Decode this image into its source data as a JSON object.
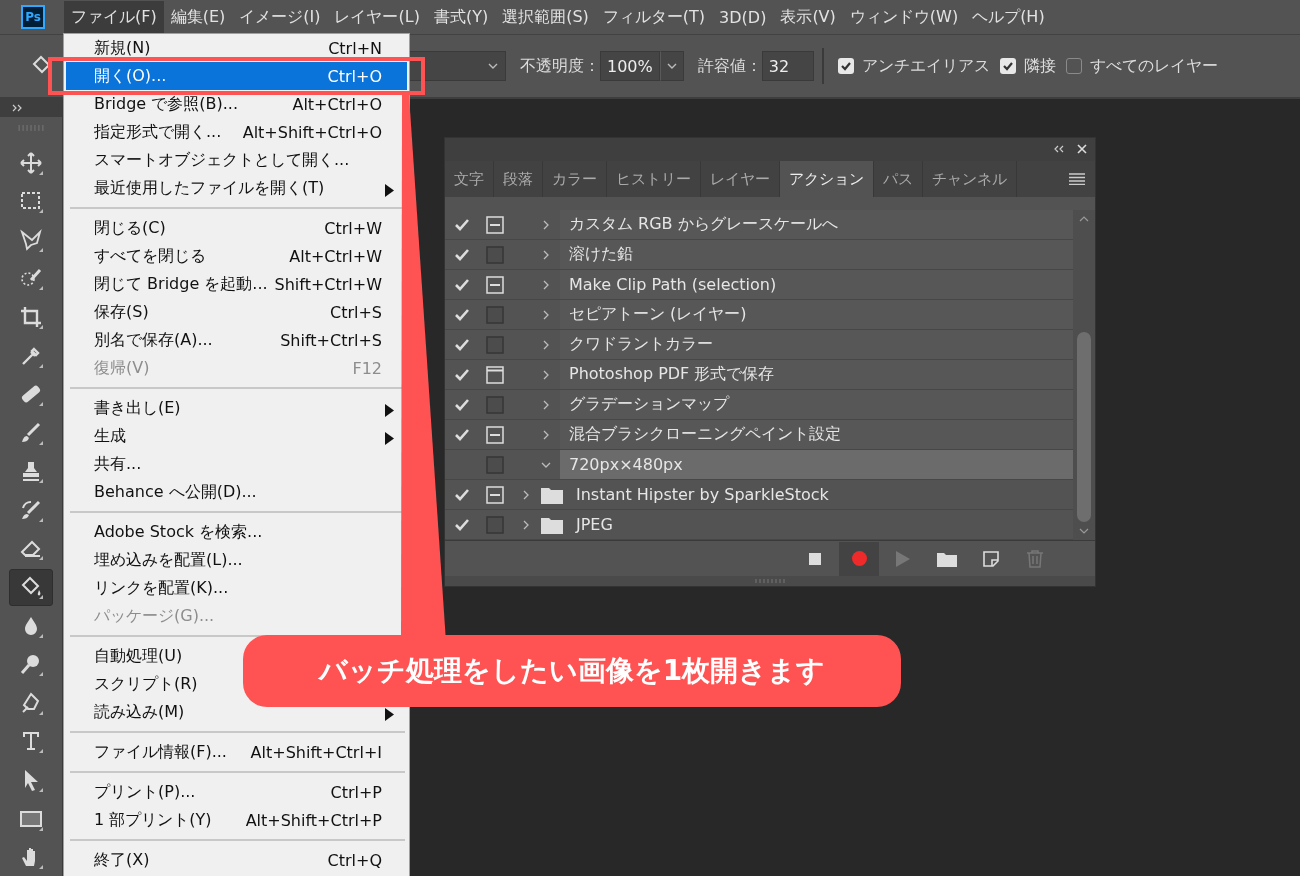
{
  "app_logo": "Ps",
  "menubar": [
    {
      "label": "ファイル(F)",
      "selected": true
    },
    {
      "label": "編集(E)",
      "selected": false
    },
    {
      "label": "イメージ(I)",
      "selected": false
    },
    {
      "label": "レイヤー(L)",
      "selected": false
    },
    {
      "label": "書式(Y)",
      "selected": false
    },
    {
      "label": "選択範囲(S)",
      "selected": false
    },
    {
      "label": "フィルター(T)",
      "selected": false
    },
    {
      "label": "3D(D)",
      "selected": false
    },
    {
      "label": "表示(V)",
      "selected": false
    },
    {
      "label": "ウィンドウ(W)",
      "selected": false
    },
    {
      "label": "ヘルプ(H)",
      "selected": false
    }
  ],
  "options_bar": {
    "opacity_label": "不透明度：",
    "opacity_value": "100%",
    "tolerance_label": "許容値：",
    "tolerance_value": "32",
    "checkboxes": [
      {
        "label": "アンチエイリアス",
        "checked": true
      },
      {
        "label": "隣接",
        "checked": true
      },
      {
        "label": "すべてのレイヤー",
        "checked": false
      }
    ]
  },
  "tools": [
    {
      "kind": "move",
      "selected": false
    },
    {
      "kind": "marquee",
      "selected": false
    },
    {
      "kind": "lasso",
      "selected": false
    },
    {
      "kind": "quick-select",
      "selected": false
    },
    {
      "kind": "crop",
      "selected": false
    },
    {
      "kind": "eyedropper",
      "selected": false
    },
    {
      "kind": "healing",
      "selected": false
    },
    {
      "kind": "brush",
      "selected": false
    },
    {
      "kind": "stamp",
      "selected": false
    },
    {
      "kind": "history-brush",
      "selected": false
    },
    {
      "kind": "eraser",
      "selected": false
    },
    {
      "kind": "bucket",
      "selected": true
    },
    {
      "kind": "blur",
      "selected": false
    },
    {
      "kind": "dodge",
      "selected": false
    },
    {
      "kind": "pen",
      "selected": false
    },
    {
      "kind": "type",
      "selected": false
    },
    {
      "kind": "path-select",
      "selected": false
    },
    {
      "kind": "rectangle",
      "selected": false
    },
    {
      "kind": "hand",
      "selected": false
    }
  ],
  "file_menu": [
    {
      "kind": "item",
      "label": "新規(N)",
      "shortcut": "Ctrl+N",
      "selected": false,
      "disabled": false,
      "submenu": false
    },
    {
      "kind": "item",
      "label": "開く(O)...",
      "shortcut": "Ctrl+O",
      "selected": true,
      "disabled": false,
      "submenu": false
    },
    {
      "kind": "item",
      "label": "Bridge で参照(B)...",
      "shortcut": "Alt+Ctrl+O",
      "selected": false,
      "disabled": false,
      "submenu": false
    },
    {
      "kind": "item",
      "label": "指定形式で開く...",
      "shortcut": "Alt+Shift+Ctrl+O",
      "selected": false,
      "disabled": false,
      "submenu": false
    },
    {
      "kind": "item",
      "label": "スマートオブジェクトとして開く...",
      "selected": false,
      "disabled": false,
      "submenu": false
    },
    {
      "kind": "item",
      "label": "最近使用したファイルを開く(T)",
      "selected": false,
      "disabled": false,
      "submenu": true
    },
    {
      "kind": "separator"
    },
    {
      "kind": "item",
      "label": "閉じる(C)",
      "shortcut": "Ctrl+W",
      "selected": false,
      "disabled": false,
      "submenu": false
    },
    {
      "kind": "item",
      "label": "すべてを閉じる",
      "shortcut": "Alt+Ctrl+W",
      "selected": false,
      "disabled": false,
      "submenu": false
    },
    {
      "kind": "item",
      "label": "閉じて Bridge を起動...",
      "shortcut": "Shift+Ctrl+W",
      "selected": false,
      "disabled": false,
      "submenu": false
    },
    {
      "kind": "item",
      "label": "保存(S)",
      "shortcut": "Ctrl+S",
      "selected": false,
      "disabled": false,
      "submenu": false
    },
    {
      "kind": "item",
      "label": "別名で保存(A)...",
      "shortcut": "Shift+Ctrl+S",
      "selected": false,
      "disabled": false,
      "submenu": false
    },
    {
      "kind": "item",
      "label": "復帰(V)",
      "shortcut": "F12",
      "selected": false,
      "disabled": true,
      "submenu": false
    },
    {
      "kind": "separator"
    },
    {
      "kind": "item",
      "label": "書き出し(E)",
      "selected": false,
      "disabled": false,
      "submenu": true
    },
    {
      "kind": "item",
      "label": "生成",
      "selected": false,
      "disabled": false,
      "submenu": true
    },
    {
      "kind": "item",
      "label": "共有...",
      "selected": false,
      "disabled": false,
      "submenu": false
    },
    {
      "kind": "item",
      "label": "Behance へ公開(D)...",
      "selected": false,
      "disabled": false,
      "submenu": false
    },
    {
      "kind": "separator"
    },
    {
      "kind": "item",
      "label": "Adobe Stock を検索...",
      "selected": false,
      "disabled": false,
      "submenu": false
    },
    {
      "kind": "item",
      "label": "埋め込みを配置(L)...",
      "selected": false,
      "disabled": false,
      "submenu": false
    },
    {
      "kind": "item",
      "label": "リンクを配置(K)...",
      "selected": false,
      "disabled": false,
      "submenu": false
    },
    {
      "kind": "item",
      "label": "パッケージ(G)...",
      "selected": false,
      "disabled": true,
      "submenu": false
    },
    {
      "kind": "separator"
    },
    {
      "kind": "item",
      "label": "自動処理(U)",
      "selected": false,
      "disabled": false,
      "submenu": false
    },
    {
      "kind": "item",
      "label": "スクリプト(R)",
      "selected": false,
      "disabled": false,
      "submenu": false
    },
    {
      "kind": "item",
      "label": "読み込み(M)",
      "selected": false,
      "disabled": false,
      "submenu": true
    },
    {
      "kind": "separator"
    },
    {
      "kind": "item",
      "label": "ファイル情報(F)...",
      "shortcut": "Alt+Shift+Ctrl+I",
      "selected": false,
      "disabled": false,
      "submenu": false
    },
    {
      "kind": "separator"
    },
    {
      "kind": "item",
      "label": "プリント(P)...",
      "shortcut": "Ctrl+P",
      "selected": false,
      "disabled": false,
      "submenu": false
    },
    {
      "kind": "item",
      "label": "1 部プリント(Y)",
      "shortcut": "Alt+Shift+Ctrl+P",
      "selected": false,
      "disabled": false,
      "submenu": false
    },
    {
      "kind": "separator"
    },
    {
      "kind": "item",
      "label": "終了(X)",
      "shortcut": "Ctrl+Q",
      "selected": false,
      "disabled": false,
      "submenu": false
    }
  ],
  "actions_panel": {
    "tabs": [
      {
        "label": "文字",
        "selected": false
      },
      {
        "label": "段落",
        "selected": false
      },
      {
        "label": "カラー",
        "selected": false
      },
      {
        "label": "ヒストリー",
        "selected": false
      },
      {
        "label": "レイヤー",
        "selected": false
      },
      {
        "label": "アクション",
        "selected": true
      },
      {
        "label": "パス",
        "selected": false
      },
      {
        "label": "チャンネル",
        "selected": false
      }
    ],
    "actions": [
      {
        "kind": "action",
        "label": "カスタム RGB からグレースケールへ",
        "enabled": true,
        "dialog_shown": true,
        "dialog_partial": true,
        "expanded": false,
        "selected": false
      },
      {
        "kind": "action",
        "label": "溶けた鉛",
        "enabled": true,
        "dialog_shown": false,
        "expanded": false,
        "selected": false
      },
      {
        "kind": "action",
        "label": "Make Clip Path (selection)",
        "enabled": true,
        "dialog_shown": true,
        "dialog_partial": true,
        "expanded": false,
        "selected": false
      },
      {
        "kind": "action",
        "label": "セピアトーン (レイヤー)",
        "enabled": true,
        "dialog_shown": false,
        "expanded": false,
        "selected": false
      },
      {
        "kind": "action",
        "label": "クワドラントカラー",
        "enabled": true,
        "dialog_shown": false,
        "expanded": false,
        "selected": false
      },
      {
        "kind": "action",
        "label": "Photoshop PDF 形式で保存",
        "enabled": true,
        "dialog_shown": true,
        "dialog_partial": false,
        "expanded": false,
        "selected": false
      },
      {
        "kind": "action",
        "label": "グラデーションマップ",
        "enabled": true,
        "dialog_shown": false,
        "expanded": false,
        "selected": false
      },
      {
        "kind": "action",
        "label": "混合ブラシクローニングペイント設定",
        "enabled": true,
        "dialog_shown": true,
        "dialog_partial": true,
        "expanded": false,
        "selected": false
      },
      {
        "kind": "action",
        "label": "720px×480px",
        "enabled": false,
        "dialog_shown": false,
        "expanded": true,
        "selected": true
      },
      {
        "kind": "set",
        "label": "Instant Hipster by SparkleStock",
        "enabled": true,
        "dialog_shown": true,
        "dialog_partial": true,
        "expanded": false,
        "selected": false
      },
      {
        "kind": "set",
        "label": "JPEG",
        "enabled": true,
        "dialog_shown": false,
        "expanded": false,
        "selected": false
      }
    ]
  },
  "annotation": {
    "text": "バッチ処理をしたい画像を1枚開きます"
  }
}
